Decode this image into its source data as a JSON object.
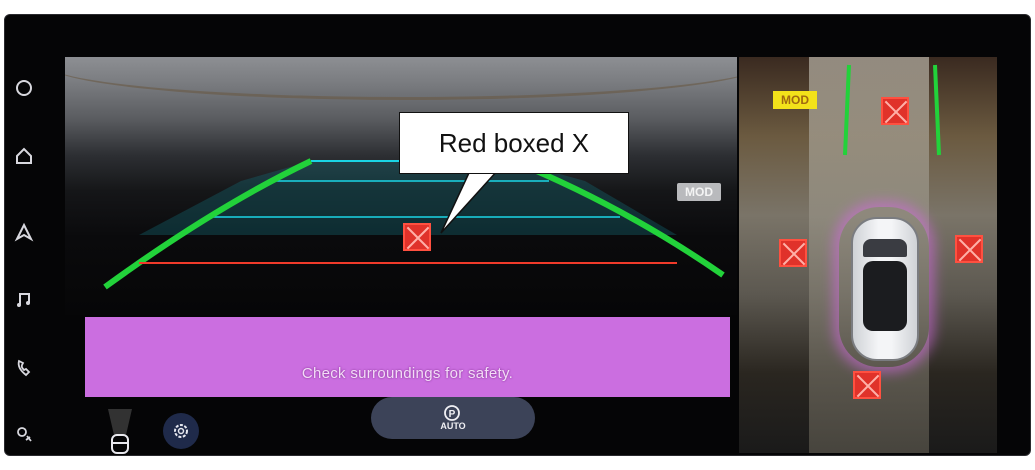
{
  "callout": {
    "text": "Red boxed X"
  },
  "rear_camera": {
    "mod_badge": "MOD"
  },
  "around_view": {
    "mod_badge": "MOD"
  },
  "warning": {
    "text": "Check surroundings for safety."
  },
  "controls": {
    "auto_label": "AUTO"
  },
  "rail": {
    "icons": [
      "power-icon",
      "home-icon",
      "navigation-icon",
      "music-icon",
      "phone-icon",
      "climate-icon"
    ]
  },
  "colors": {
    "warning_bar": "#cb6ee0",
    "guide_green": "#22d23a",
    "guide_cyan": "#1ad6e6",
    "guide_red": "#f03a2a",
    "error_x": "#e0322a",
    "mod_yellow": "#f3e21a"
  }
}
